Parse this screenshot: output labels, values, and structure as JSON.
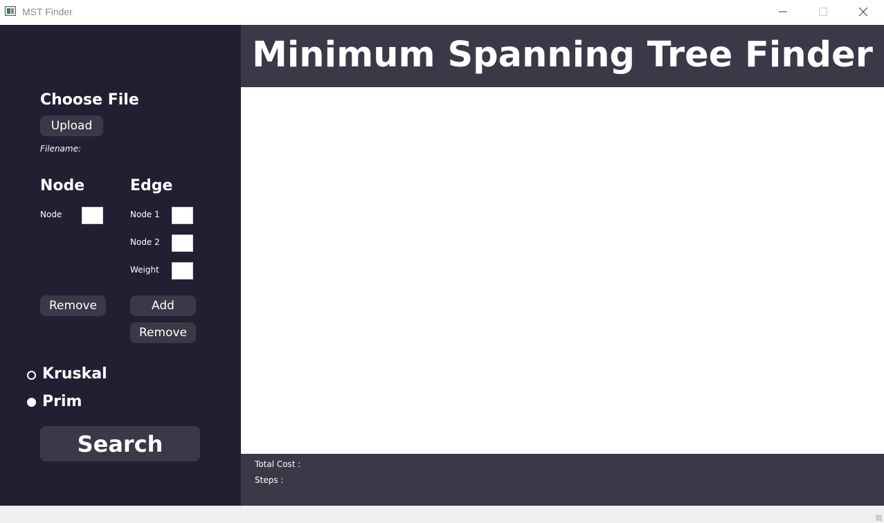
{
  "window": {
    "title": "MST Finder",
    "icons": [
      "app-icon",
      "minimize-icon",
      "maximize-icon",
      "close-icon"
    ]
  },
  "header": {
    "title": "Minimum Spanning Tree Finder"
  },
  "file": {
    "heading": "Choose File",
    "upload_label": "Upload",
    "filename_label": "Filename:"
  },
  "node": {
    "heading": "Node",
    "field_label": "Node",
    "value": "",
    "remove_label": "Remove"
  },
  "edge": {
    "heading": "Edge",
    "node1_label": "Node 1",
    "node1_value": "",
    "node2_label": "Node 2",
    "node2_value": "",
    "weight_label": "Weight",
    "weight_value": "",
    "add_label": "Add",
    "remove_label": "Remove"
  },
  "algorithm": {
    "options": [
      {
        "label": "Kruskal",
        "selected": false
      },
      {
        "label": "Prim",
        "selected": true
      }
    ]
  },
  "search_label": "Search",
  "results": {
    "total_cost_label": "Total Cost :",
    "steps_label": "Steps :"
  },
  "colors": {
    "sidebar": "#231f33",
    "panel": "#3c3847",
    "canvas": "#ffffff",
    "text": "#ffffff"
  }
}
